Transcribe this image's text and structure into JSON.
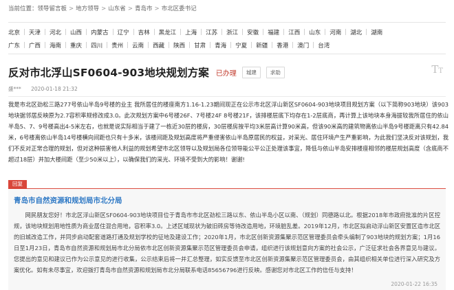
{
  "breadcrumb": {
    "prefix": "当前位置：",
    "items": [
      "领导留言板",
      "地方领导",
      "山东省",
      "青岛市",
      "市北区委书记"
    ],
    "separator": ">"
  },
  "regions": {
    "row1": [
      "北京",
      "天津",
      "河北",
      "山西",
      "内蒙古",
      "辽宁",
      "吉林",
      "黑龙江",
      "上海",
      "江苏",
      "浙江",
      "安徽",
      "福建",
      "江西",
      "山东",
      "河南",
      "湖北",
      "湖南"
    ],
    "row2": [
      "广东",
      "广西",
      "海南",
      "重庆",
      "四川",
      "贵州",
      "云南",
      "西藏",
      "陕西",
      "甘肃",
      "青海",
      "宁夏",
      "新疆",
      "香港",
      "澳门",
      "台湾"
    ]
  },
  "post": {
    "title": "反对市北浮山SF0604-903地块规划方案",
    "status": "已办理",
    "tags": [
      "城建",
      "求助"
    ],
    "author": "盛***",
    "date": "2020-01-18 21:32",
    "content": "我是市北区劲松三路277号依山半岛9号楼的业主  我所居住的楼座南方1.16-1.23期间现正在公示市北区浮山新区SF0604-903地块项目规划方案（以下简称903地块）该903地块据邻居反映原为2.7容积率规修改成3.0。此次规划方案中6号楼26F、7号楼24F 8号楼21F，该排楼层底下均存在1-2层底商，再计算上该地块本身海拔较我所居住的依山半岛5、7、9号楼高出4-5米左右，也就是说实际相当于建了一栋近30层的楼房，30层楼房按平均3米层高计算90米高，但该90米高的建筑物离依山半岛9号楼距离只有42.84米，6号楼离依山半岛14号楼横向间距也只有十多米，该楼间距及规划高度将严重侵害依山半岛原居民的权益，对采光、居住环境产生严重影响，为此我们坚决反对该规划，我们不反对正常合理的规划，但对这种损害他人利益的规划希望市北区领导以及规划局各位领导能公平公正处理该事宜，降低与依山半岛安排楼座相邻的楼层规划高度（含底商不超过18层）并加大楼间距（至少50米以上），以确保我们的采光、环境不受到大的影响！谢谢!"
  },
  "reply": {
    "label": "回复",
    "org": "青岛市自然资源和规划局市北分局",
    "content": "网民朋友您好！市北区浮山新区SF0604-903地块项目位于青岛市市北区劲松三路以东、依山半岛小区以南、（规划）同德路以北。根据2018年市政府批准的片区控规，该地块规划用地性质为商业居住混合用地，容积率3.0。上述区域现状为破旧砖房等待改造用地，环境脏乱差。2019年12月，市北区拟启动浮山新区安置区造市北区的旧城改造工作，并同步启动配套道路打通及规划学校的征地及建设工作；2020年1月，市北区创新资源集聚示范区管理委员会牵头编制了903地块的规划方案；1月16日至1月23日，青岛市自然资源和规划局市北分局依市北区创新资源集聚示范区管理委员会申请，组织进行该规划意向方案的社会公示，广泛征求社会各界意见与建议。您提出的意见和建议已作为公示意见的进行收集，公示结束后将一并汇总整理，如实反馈至市北区创新资源集聚示范区管理委员会，由其组织相关单位进行深入研究及方案优化。如有未尽事宜，欢迎拨打青岛市自然资源和规划局市北分局联系电话85656796进行反映。感谢您对市北区工作的信任与支持！",
    "date": "2020-01-22 16:35"
  },
  "icons": {
    "font_size": "font-size-toggle-icon"
  },
  "colors": {
    "accent_red": "#c0392b",
    "reply_label": "#d9463a",
    "org_blue": "#2f79c5"
  }
}
